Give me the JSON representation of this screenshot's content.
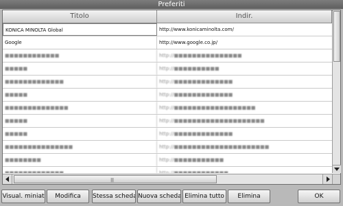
{
  "window": {
    "title": "Preferiti"
  },
  "table": {
    "headers": {
      "title": "Titolo",
      "url": "Indir."
    },
    "rows": [
      {
        "title": "KONICA MINOLTA Global",
        "url": "http://www.konicaminolta.com/",
        "blurred": false
      },
      {
        "title": "Google",
        "url": "http://www.google.co.jp/",
        "blurred": false
      },
      {
        "title": "■■■■■■■■■■■■",
        "url": "http://■■■■■■■■■■■■■■■",
        "blurred": true
      },
      {
        "title": "■■■■■",
        "url": "http://■■■■■■■■■■",
        "blurred": true
      },
      {
        "title": "■■■■■■■■■■■■■",
        "url": "http://■■■■■■■■■■■■■",
        "blurred": true
      },
      {
        "title": "■■■■■",
        "url": "http://■■■■■■■■■■■■■",
        "blurred": true
      },
      {
        "title": "■■■■■■■■■■■■■■",
        "url": "http://■■■■■■■■■■■■■■■■■■",
        "blurred": true
      },
      {
        "title": "■■■■■",
        "url": "http://■■■■■■■■■■■■■■■■■■■■",
        "blurred": true
      },
      {
        "title": "■■■■■",
        "url": "http://■■■■■■■■■■■■■",
        "blurred": true
      },
      {
        "title": "■■■■■■■■■■■■■■■",
        "url": "http://■■■■■■■■■■■■■■■■■■■■■",
        "blurred": true
      },
      {
        "title": "■■■■■■■■",
        "url": "http://■■■■■■■■■■■",
        "blurred": true
      },
      {
        "title": "■■■■■■■■■■■■■",
        "url": "http://■■■■■■■■■■■■",
        "blurred": true
      }
    ]
  },
  "toolbar": {
    "thumbnail_label": "Visual. miniat",
    "edit_label": "Modifica",
    "same_tab_label": "Stessa scheda",
    "new_tab_label": "Nuova scheda",
    "delete_all_label": "Elimina tutto",
    "delete_label": "Elimina",
    "ok_label": "OK"
  },
  "scroll": {
    "vertical_position": 0.0,
    "horizontal_position": 0.0
  }
}
